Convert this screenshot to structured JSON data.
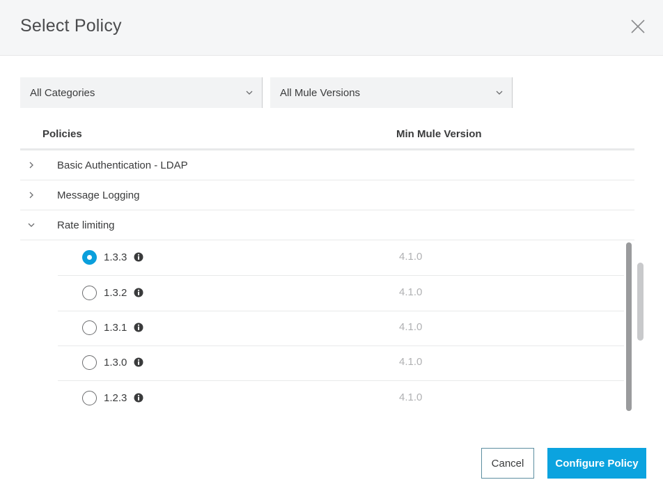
{
  "dialog": {
    "title": "Select Policy",
    "close_icon": "close-icon"
  },
  "filters": {
    "category": {
      "selected": "All Categories",
      "icon": "chevron-down-icon"
    },
    "mule_version": {
      "selected": "All Mule Versions",
      "icon": "chevron-down-icon"
    }
  },
  "table": {
    "headers": {
      "policies": "Policies",
      "min_mule_version": "Min Mule Version"
    },
    "groups": [
      {
        "label": "Basic Authentication - LDAP",
        "expanded": false,
        "icon": "chevron-right-icon"
      },
      {
        "label": "Message Logging",
        "expanded": false,
        "icon": "chevron-right-icon"
      },
      {
        "label": "Rate limiting",
        "expanded": true,
        "icon": "chevron-down-icon"
      }
    ],
    "rate_limiting_versions": [
      {
        "version": "1.3.3",
        "min_mule": "4.1.0",
        "selected": true
      },
      {
        "version": "1.3.2",
        "min_mule": "4.1.0",
        "selected": false
      },
      {
        "version": "1.3.1",
        "min_mule": "4.1.0",
        "selected": false
      },
      {
        "version": "1.3.0",
        "min_mule": "4.1.0",
        "selected": false
      },
      {
        "version": "1.2.3",
        "min_mule": "4.1.0",
        "selected": false
      }
    ],
    "info_icon": "info-icon"
  },
  "actions": {
    "cancel_label": "Cancel",
    "configure_label": "Configure Policy"
  },
  "colors": {
    "accent": "#0ba3df",
    "radio_selected": "#0a9fdc",
    "header_bg": "#f5f6f7",
    "muted_text": "#b0b1b3"
  }
}
